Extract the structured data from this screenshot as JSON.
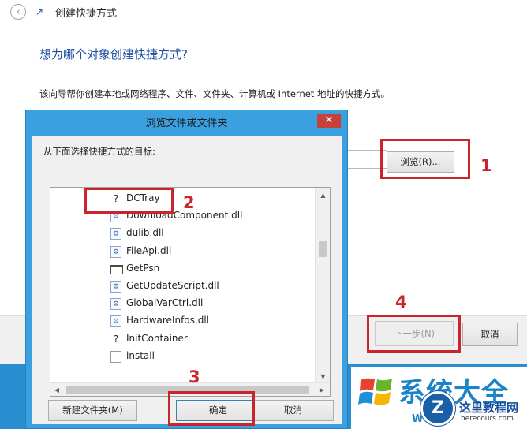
{
  "wizard": {
    "title": "创建快捷方式",
    "back_icon": "‹",
    "question": "想为哪个对象创建快捷方式?",
    "description": "该向导帮你创建本地或网络程序、文件、文件夹、计算机或 Internet 地址的快捷方式。",
    "browse_label": "浏览(R)...",
    "next_label": "下一步(N)",
    "cancel_label": "取消"
  },
  "dialog": {
    "title": "浏览文件或文件夹",
    "close_glyph": "✕",
    "prompt": "从下面选择快捷方式的目标:",
    "items": [
      {
        "name": "DCTray",
        "icon": "?"
      },
      {
        "name": "DownloadComponent.dll",
        "icon": "⚙"
      },
      {
        "name": "dulib.dll",
        "icon": "⚙"
      },
      {
        "name": "FileApi.dll",
        "icon": "⚙"
      },
      {
        "name": "GetPsn",
        "icon": ""
      },
      {
        "name": "GetUpdateScript.dll",
        "icon": "⚙"
      },
      {
        "name": "GlobalVarCtrl.dll",
        "icon": "⚙"
      },
      {
        "name": "HardwareInfos.dll",
        "icon": "⚙"
      },
      {
        "name": "InitContainer",
        "icon": "?"
      },
      {
        "name": "install",
        "icon": ""
      }
    ],
    "new_folder_label": "新建文件夹(M)",
    "ok_label": "确定",
    "cancel_label": "取消"
  },
  "annotations": {
    "step1": "1",
    "step2": "2",
    "step3": "3",
    "step4": "4",
    "color": "#c9252c"
  },
  "watermark": {
    "big_text": "系统大全",
    "site_name": "这里教程网",
    "url": "herecours.com",
    "small_w": "W",
    "seal": "Z"
  }
}
